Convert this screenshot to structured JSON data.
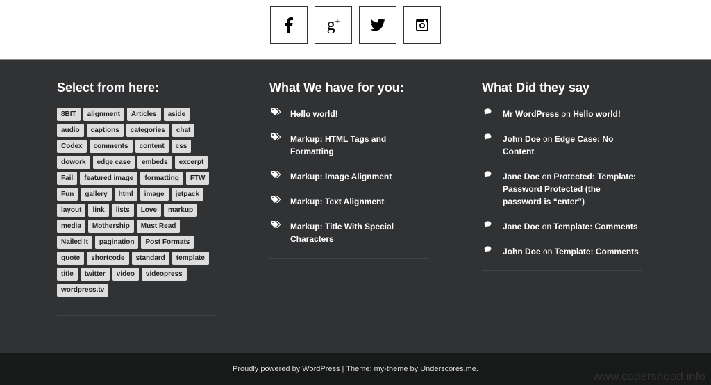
{
  "social": [
    {
      "name": "facebook",
      "glyph": "f"
    },
    {
      "name": "google-plus",
      "glyph": "g+"
    },
    {
      "name": "twitter",
      "glyph": "twitter"
    },
    {
      "name": "instagram",
      "glyph": "instagram"
    }
  ],
  "col1": {
    "title": "Select from here:",
    "tags": [
      "8BIT",
      "alignment",
      "Articles",
      "aside",
      "audio",
      "captions",
      "categories",
      "chat",
      "Codex",
      "comments",
      "content",
      "css",
      "dowork",
      "edge case",
      "embeds",
      "excerpt",
      "Fail",
      "featured image",
      "formatting",
      "FTW",
      "Fun",
      "gallery",
      "html",
      "image",
      "jetpack",
      "layout",
      "link",
      "lists",
      "Love",
      "markup",
      "media",
      "Mothership",
      "Must Read",
      "Nailed It",
      "pagination",
      "Post Formats",
      "quote",
      "shortcode",
      "standard",
      "template",
      "title",
      "twitter",
      "video",
      "videopress",
      "wordpress.tv"
    ]
  },
  "col2": {
    "title": "What We have for you:",
    "posts": [
      "Hello world!",
      "Markup: HTML Tags and Formatting",
      "Markup: Image Alignment",
      "Markup: Text Alignment",
      "Markup: Title With Special Characters"
    ]
  },
  "col3": {
    "title": "What Did they say",
    "comments": [
      {
        "author": "Mr WordPress",
        "on": "on",
        "post": "Hello world!"
      },
      {
        "author": "John Doe",
        "on": "on",
        "post": "Edge Case: No Content"
      },
      {
        "author": "Jane Doe",
        "on": "on",
        "post": "Protected: Template: Password Protected (the password is “enter”)"
      },
      {
        "author": "Jane Doe",
        "on": "on",
        "post": "Template: Comments"
      },
      {
        "author": "John Doe",
        "on": "on",
        "post": "Template: Comments"
      }
    ]
  },
  "footer": {
    "text": "Proudly powered by WordPress | Theme: my-theme by Underscores.me."
  },
  "watermark": "www.codershood.info"
}
